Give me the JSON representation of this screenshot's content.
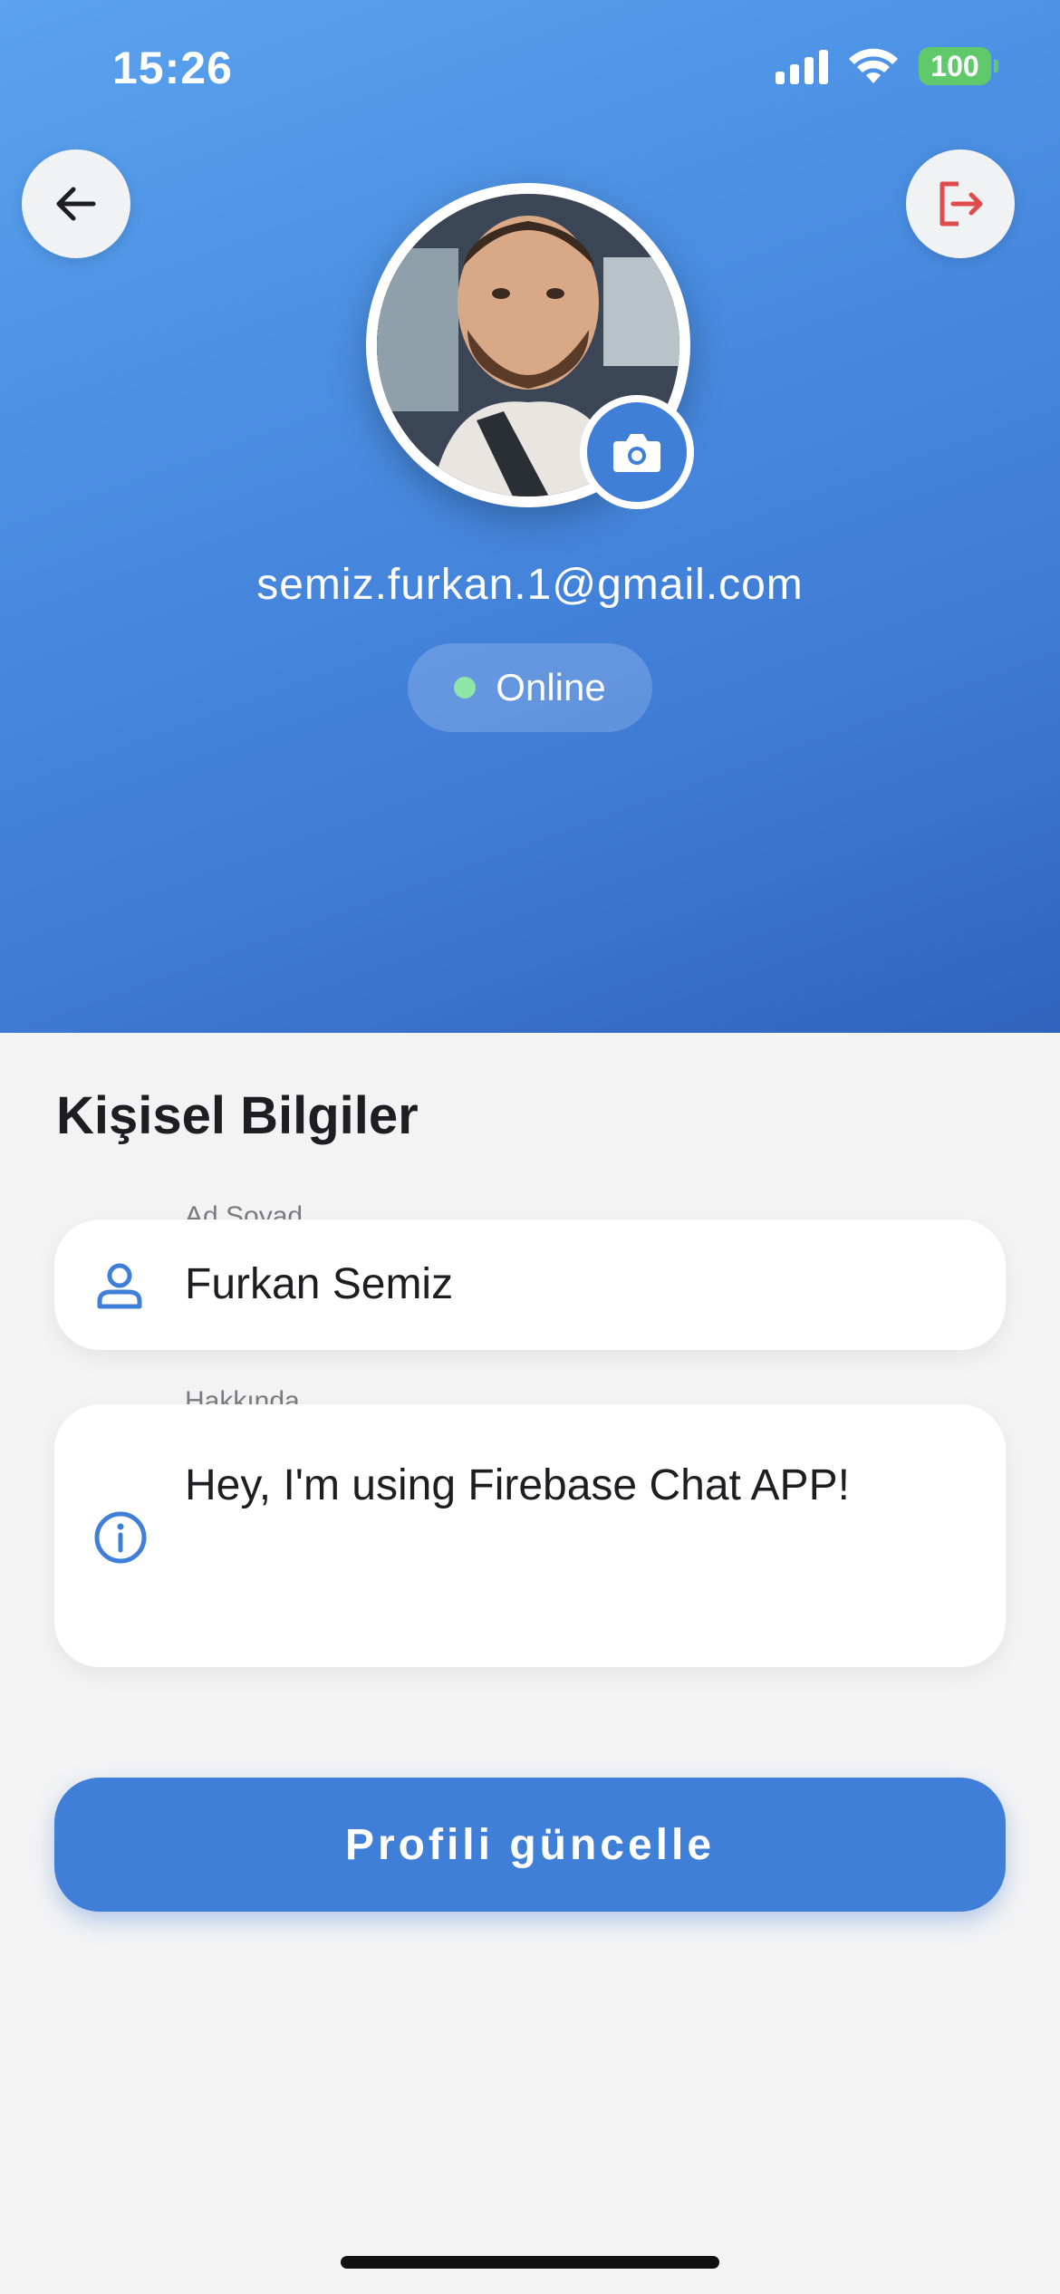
{
  "status_bar": {
    "time": "15:26",
    "battery": "100"
  },
  "profile": {
    "email": "semiz.furkan.1@gmail.com",
    "status": "Online"
  },
  "personal_info": {
    "title": "Kişisel Bilgiler",
    "name_label": "Ad Soyad",
    "name_value": "Furkan Semiz",
    "about_label": "Hakkında",
    "about_value": "Hey, I'm using Firebase Chat APP!"
  },
  "actions": {
    "update_label": "Profili güncelle"
  },
  "colors": {
    "accent": "#3f7fd8",
    "logout": "#e04b4b",
    "online": "#8ee6a8"
  },
  "icons": {
    "back": "arrow-left-icon",
    "logout": "logout-icon",
    "camera": "camera-icon",
    "person": "person-icon",
    "info": "info-icon"
  }
}
